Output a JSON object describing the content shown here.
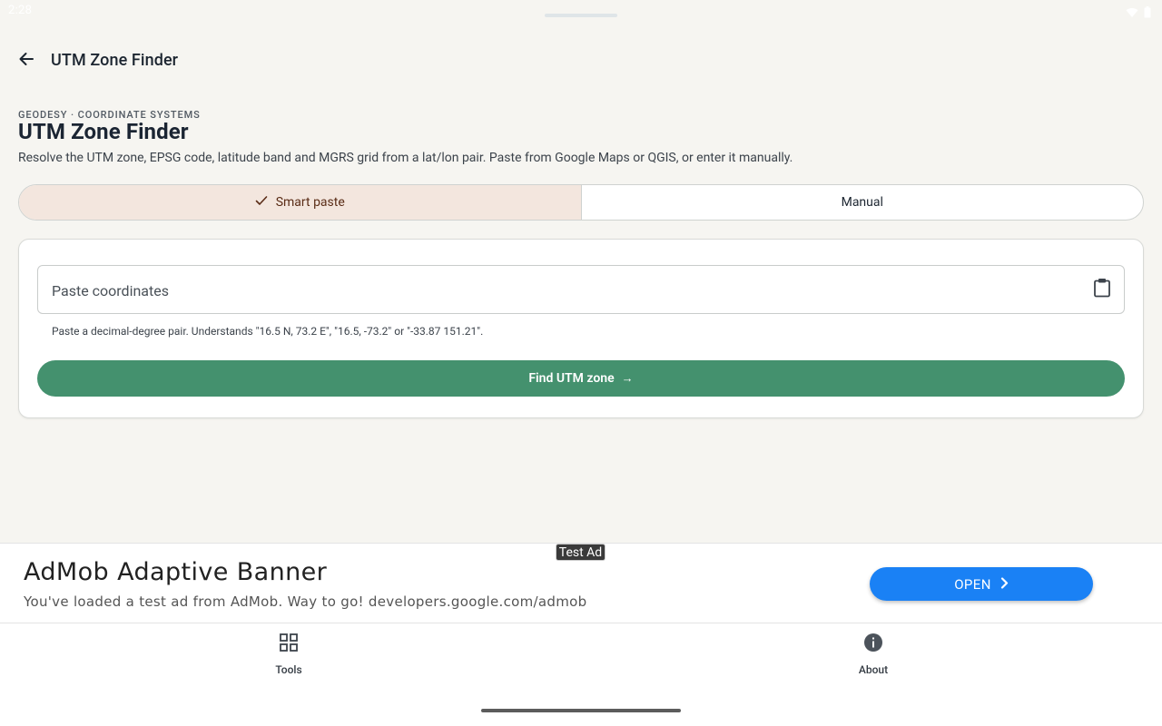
{
  "status_bar": {
    "time": "2:28",
    "icons": [
      "wifi-icon",
      "battery-icon"
    ]
  },
  "top_bar": {
    "back_icon": "arrow-left-icon",
    "title": "UTM Zone Finder"
  },
  "header": {
    "overline": "GEODESY · COORDINATE SYSTEMS",
    "title": "UTM Zone Finder",
    "description": "Resolve the UTM zone, EPSG code, latitude band and MGRS grid from a lat/lon pair. Paste from Google Maps or QGIS, or enter it manually."
  },
  "mode_tabs": [
    {
      "label": "Smart paste",
      "selected": true,
      "icon": "check-icon"
    },
    {
      "label": "Manual",
      "selected": false
    }
  ],
  "input_card": {
    "field": {
      "placeholder": "Paste coordinates",
      "value": "",
      "trailing_icon": "clipboard-icon"
    },
    "helper_text": "Paste a decimal-degree pair. Understands \"16.5 N, 73.2 E\", \"16.5, -73.2\" or \"-33.87 151.21\".",
    "submit": {
      "label": "Find UTM zone",
      "arrow": "→"
    }
  },
  "ad": {
    "badge": "Test Ad",
    "title": "AdMob Adaptive Banner",
    "subtitle": "You've loaded a test ad from AdMob. Way to go! developers.google.com/admob",
    "cta": "OPEN"
  },
  "bottom_nav": [
    {
      "label": "Tools",
      "icon": "grid-icon"
    },
    {
      "label": "About",
      "icon": "info-icon"
    }
  ],
  "colors": {
    "background": "#f6f5f1",
    "accent_green": "#44916e",
    "selected_tab_bg": "#f3e6de",
    "ad_button_blue": "#1a81f5"
  }
}
